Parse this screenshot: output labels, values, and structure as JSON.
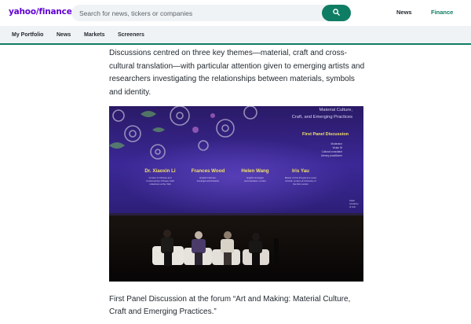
{
  "header": {
    "logo_yahoo": "yahoo",
    "logo_slash": "/",
    "logo_finance": "finance",
    "search_placeholder": "Search for news, tickers or companies",
    "links": {
      "news": "News",
      "finance": "Finance"
    },
    "accent_color": "#0f7d63",
    "brand_color": "#6001d2"
  },
  "subnav": {
    "items": [
      "My Portfolio",
      "News",
      "Markets",
      "Screeners"
    ]
  },
  "article": {
    "paragraph": "Discussions centred on three key themes—material, craft and cross-cultural translation—with particular attention given to emerging artists and researchers investigating the relationships between materials, symbols and identity.",
    "photo": {
      "screen_title_line1": "Material Culture,",
      "screen_title_line2": "Craft, and Emerging Practices",
      "panel_heading": "First Panel Discussion",
      "moderator_lines": [
        "Moderator",
        "Vivian W",
        "Cultural consultant",
        "Literary practitioner"
      ],
      "speakers": [
        {
          "name": "Dr. Xiaoxin Li",
          "sub1": "Curator of Chinese and",
          "sub2": "Contemporary Chinese Craft",
          "sub3": "collections at the V&A"
        },
        {
          "name": "Frances Wood",
          "sub1": "English historian,",
          "sub2": "sinologist and historian",
          "sub3": ""
        },
        {
          "name": "Helen Wang",
          "sub1": "English sinologist",
          "sub2": "and translator, London",
          "sub3": ""
        },
        {
          "name": "Iris Yau",
          "sub1": "Master of Arts Programme Lead,",
          "sub2": "Artcraft, London at University of",
          "sub3": "the Arts London"
        }
      ],
      "side_note": [
        "Asian",
        "Academy",
        "of Arts"
      ]
    },
    "caption": "First Panel Discussion at the forum “Art and Making: Material Culture, Craft and Emerging Practices.”"
  }
}
